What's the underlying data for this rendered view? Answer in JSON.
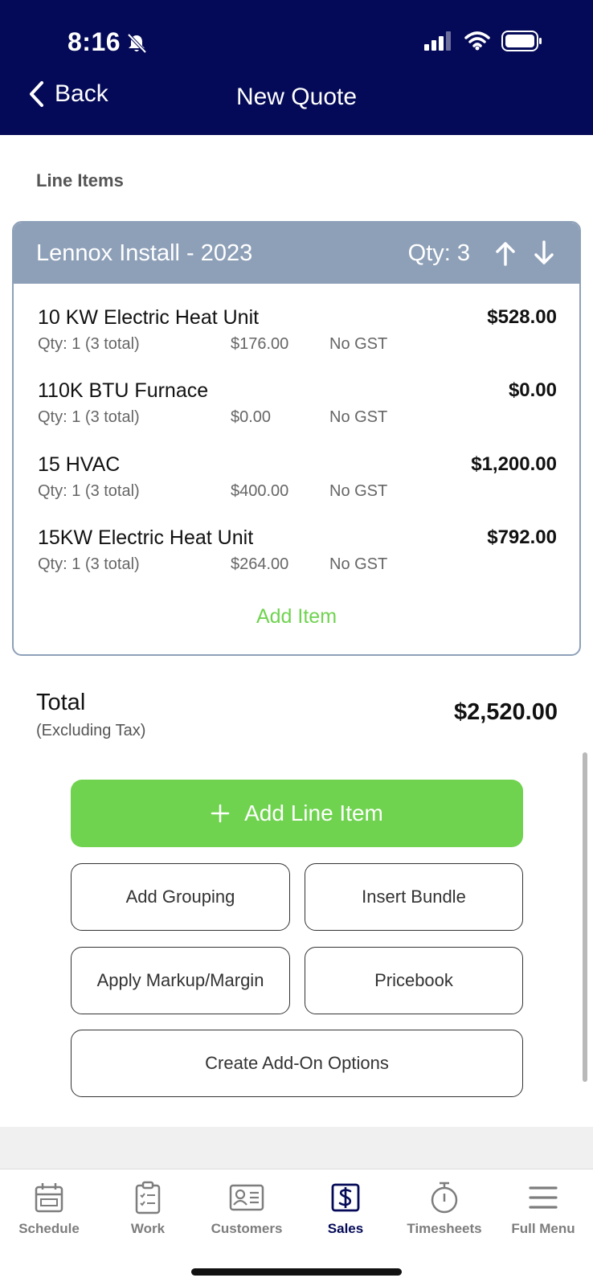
{
  "status": {
    "time": "8:16",
    "icons": [
      "bell-off-icon",
      "signal-icon",
      "wifi-icon",
      "battery-icon"
    ]
  },
  "header": {
    "back_label": "Back",
    "title": "New Quote"
  },
  "line_items_label": "Line Items",
  "group": {
    "title": "Lennox Install - 2023",
    "qty": "Qty: 3",
    "items": [
      {
        "name": "10 KW Electric Heat Unit",
        "total": "$528.00",
        "qty": "Qty: 1 (3 total)",
        "price": "$176.00",
        "tax": "No GST"
      },
      {
        "name": "110K BTU Furnace",
        "total": "$0.00",
        "qty": "Qty: 1 (3 total)",
        "price": "$0.00",
        "tax": "No GST"
      },
      {
        "name": "15 HVAC",
        "total": "$1,200.00",
        "qty": "Qty: 1 (3 total)",
        "price": "$400.00",
        "tax": "No GST"
      },
      {
        "name": "15KW Electric Heat Unit",
        "total": "$792.00",
        "qty": "Qty: 1 (3 total)",
        "price": "$264.00",
        "tax": "No GST"
      }
    ],
    "add_item_label": "Add Item"
  },
  "total": {
    "label": "Total",
    "sublabel": "(Excluding Tax)",
    "value": "$2,520.00"
  },
  "actions": {
    "add_line_item": "Add Line Item",
    "add_grouping": "Add Grouping",
    "insert_bundle": "Insert Bundle",
    "apply_markup": "Apply Markup/Margin",
    "pricebook": "Pricebook",
    "create_addon": "Create Add-On Options"
  },
  "tabs": [
    {
      "label": "Schedule",
      "icon": "calendar-icon",
      "active": false
    },
    {
      "label": "Work",
      "icon": "clipboard-icon",
      "active": false
    },
    {
      "label": "Customers",
      "icon": "contact-card-icon",
      "active": false
    },
    {
      "label": "Sales",
      "icon": "dollar-icon",
      "active": true
    },
    {
      "label": "Timesheets",
      "icon": "stopwatch-icon",
      "active": false
    },
    {
      "label": "Full Menu",
      "icon": "hamburger-icon",
      "active": false
    }
  ],
  "colors": {
    "header_bg": "#040a57",
    "group_header": "#8ea0b8",
    "accent_green": "#6fd34f",
    "active_tab": "#040a57"
  }
}
